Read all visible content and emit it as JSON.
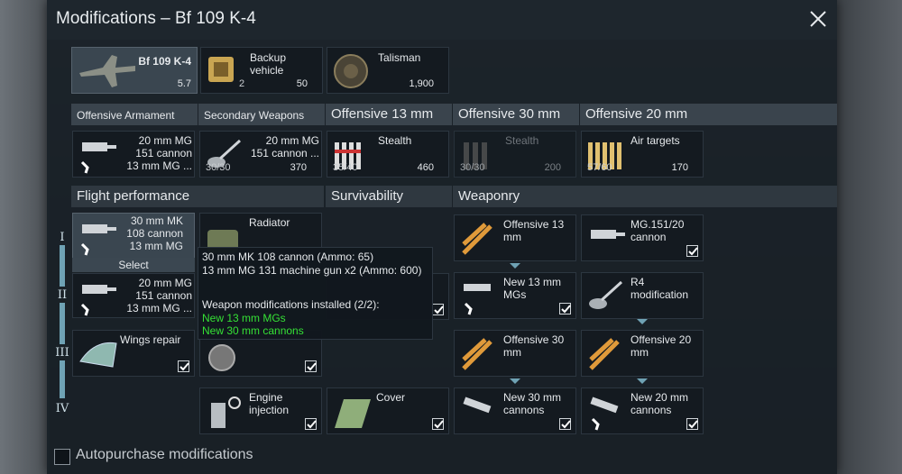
{
  "window": {
    "title": "Modifications – Bf 109 K-4"
  },
  "vehicles": {
    "plane": {
      "name": "Bf 109 K-4",
      "br": "5.7"
    },
    "backup": {
      "label": "Backup vehicle",
      "count": "2",
      "cost": "50"
    },
    "talisman": {
      "label": "Talisman",
      "cost": "1,900"
    }
  },
  "weapon_tabs": [
    {
      "label": "Offensive Armament"
    },
    {
      "label": "Secondary Weapons"
    },
    {
      "label": "Offensive 13 mm"
    },
    {
      "label": "Offensive 30 mm"
    },
    {
      "label": "Offensive 20 mm"
    }
  ],
  "weapon_cards": [
    {
      "line1": "20 mm MG",
      "line2": "151 cannon",
      "line3": "13 mm MG ..."
    },
    {
      "line1": "20 mm MG",
      "line2": "151 cannon ...",
      "count": "30/30",
      "cost": "370"
    },
    {
      "label": "Stealth",
      "count": "35/40",
      "cost": "460"
    },
    {
      "label": "Stealth",
      "count": "30/30",
      "cost": "200"
    },
    {
      "label": "Air targets",
      "count": "57/60",
      "cost": "170"
    }
  ],
  "sections": {
    "flight": "Flight performance",
    "survivability": "Survivability",
    "weaponry": "Weaponry"
  },
  "tiers": [
    "I",
    "II",
    "III",
    "IV"
  ],
  "flight_cards": [
    {
      "line1": "30 mm MK",
      "line2": "108 cannon",
      "line3": "13 mm MG ..."
    },
    {
      "line1": "20 mm MG",
      "line2": "151 cannon",
      "line3": "13 mm MG ..."
    },
    {
      "label": "Wings repair"
    }
  ],
  "select_label": "Select",
  "survival_cards": [
    {
      "label": "Radiator"
    },
    {
      "label": "Engine injection"
    },
    {
      "label": "Cover"
    }
  ],
  "weaponry_cards": [
    {
      "label": "Offensive 13 mm"
    },
    {
      "label": "MG.151/20 cannon"
    },
    {
      "label": "New 13 mm MGs"
    },
    {
      "label": "R4 modification"
    },
    {
      "label": "Offensive 30 mm"
    },
    {
      "label": "Offensive 20 mm"
    },
    {
      "label": "New 30 mm cannons"
    },
    {
      "label": "New 20 mm cannons"
    }
  ],
  "tooltip": {
    "line1": "30 mm MK 108 cannon (Ammo: 65)",
    "line2": "13 mm MG 131 machine gun x2 (Ammo: 600)",
    "line3": "Weapon modifications installed (2/2):",
    "line4": "New 13 mm MGs",
    "line5": "New 30 mm cannons"
  },
  "autopurchase": {
    "label": "Autopurchase modifications"
  },
  "colors": {
    "accent": "#6fa2b4",
    "installed": "#35e035",
    "gold": "#d9b24a"
  },
  "icons": [
    "close-icon",
    "plane-icon",
    "backup-icon",
    "talisman-icon",
    "cannon-icon",
    "bullet-icon",
    "check-icon",
    "wrench-icon",
    "radiator-icon",
    "engine-icon",
    "cover-icon"
  ]
}
